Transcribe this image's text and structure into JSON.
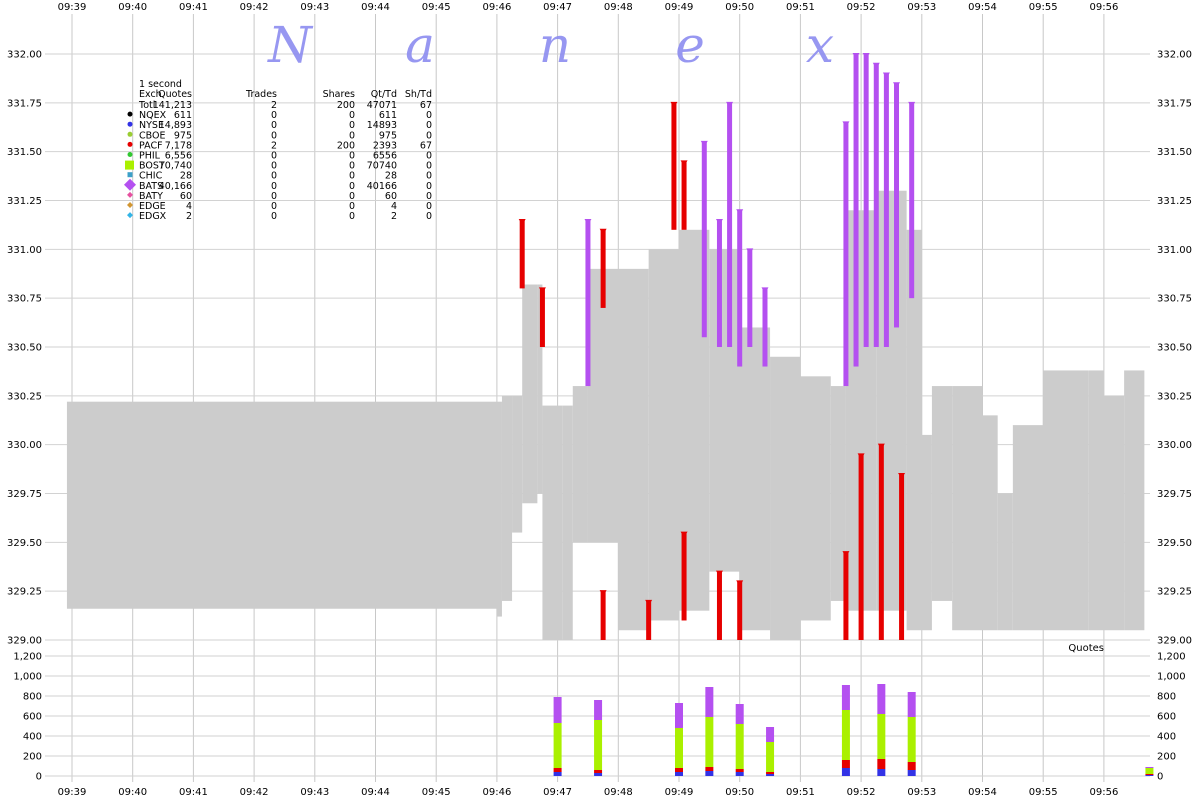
{
  "watermark": [
    "N",
    "a",
    "n",
    "e",
    "x"
  ],
  "chart_data": {
    "type": "line",
    "time_ticks": [
      "09:39",
      "09:40",
      "09:41",
      "09:42",
      "09:43",
      "09:44",
      "09:45",
      "09:46",
      "09:47",
      "09:48",
      "09:49",
      "09:50",
      "09:51",
      "09:52",
      "09:53",
      "09:54",
      "09:55",
      "09:56"
    ],
    "price_panel": {
      "ylim": [
        329.0,
        332.0
      ],
      "y_ticks": [
        "329.00",
        "329.25",
        "329.50",
        "329.75",
        "330.00",
        "330.25",
        "330.50",
        "330.75",
        "331.00",
        "331.25",
        "331.50",
        "331.75",
        "332.00"
      ],
      "nbbo_band": [
        {
          "t": "09:38:55",
          "bid": 329.16,
          "ask": 330.22
        },
        {
          "t": "09:46:00",
          "bid": 329.16,
          "ask": 330.22
        },
        {
          "t": "09:46:00",
          "bid": 329.12,
          "ask": 330.22
        },
        {
          "t": "09:46:05",
          "bid": 329.2,
          "ask": 330.25
        },
        {
          "t": "09:46:15",
          "bid": 329.55,
          "ask": 330.25
        },
        {
          "t": "09:46:25",
          "bid": 329.7,
          "ask": 330.82
        },
        {
          "t": "09:46:40",
          "bid": 329.75,
          "ask": 330.82
        },
        {
          "t": "09:46:45",
          "bid": 329.0,
          "ask": 330.2
        },
        {
          "t": "09:47:05",
          "bid": 329.0,
          "ask": 330.2
        },
        {
          "t": "09:47:15",
          "bid": 329.5,
          "ask": 330.3
        },
        {
          "t": "09:47:30",
          "bid": 329.5,
          "ask": 330.9
        },
        {
          "t": "09:48:00",
          "bid": 329.05,
          "ask": 330.9
        },
        {
          "t": "09:48:30",
          "bid": 329.1,
          "ask": 331.0
        },
        {
          "t": "09:49:00",
          "bid": 329.15,
          "ask": 331.1
        },
        {
          "t": "09:49:30",
          "bid": 329.35,
          "ask": 331.0
        },
        {
          "t": "09:50:00",
          "bid": 329.05,
          "ask": 330.6
        },
        {
          "t": "09:50:30",
          "bid": 329.0,
          "ask": 330.45
        },
        {
          "t": "09:51:00",
          "bid": 329.1,
          "ask": 330.35
        },
        {
          "t": "09:51:30",
          "bid": 329.2,
          "ask": 330.3
        },
        {
          "t": "09:51:45",
          "bid": 329.15,
          "ask": 331.2
        },
        {
          "t": "09:52:15",
          "bid": 329.15,
          "ask": 331.3
        },
        {
          "t": "09:52:45",
          "bid": 329.05,
          "ask": 331.1
        },
        {
          "t": "09:53:00",
          "bid": 329.05,
          "ask": 330.05
        },
        {
          "t": "09:53:10",
          "bid": 329.2,
          "ask": 330.3
        },
        {
          "t": "09:53:30",
          "bid": 329.05,
          "ask": 330.3
        },
        {
          "t": "09:54:00",
          "bid": 329.05,
          "ask": 330.15
        },
        {
          "t": "09:54:15",
          "bid": 329.05,
          "ask": 329.75
        },
        {
          "t": "09:54:30",
          "bid": 329.05,
          "ask": 330.1
        },
        {
          "t": "09:55:00",
          "bid": 329.05,
          "ask": 330.38
        },
        {
          "t": "09:55:45",
          "bid": 329.05,
          "ask": 330.38
        },
        {
          "t": "09:56:00",
          "bid": 329.05,
          "ask": 330.25
        },
        {
          "t": "09:56:20",
          "bid": 329.05,
          "ask": 330.38
        },
        {
          "t": "09:56:40",
          "bid": 329.05,
          "ask": 330.38
        }
      ],
      "quote_spikes": [
        {
          "t": "09:46:25",
          "exch": "PACF",
          "from": 330.8,
          "to": 331.15
        },
        {
          "t": "09:46:45",
          "exch": "PACF",
          "from": 330.5,
          "to": 330.8
        },
        {
          "t": "09:47:30",
          "exch": "BATS",
          "from": 330.3,
          "to": 331.15
        },
        {
          "t": "09:47:45",
          "exch": "PACF",
          "from": 330.7,
          "to": 331.1
        },
        {
          "t": "09:48:55",
          "exch": "PACF",
          "from": 331.1,
          "to": 331.75
        },
        {
          "t": "09:49:05",
          "exch": "PACF",
          "from": 331.1,
          "to": 331.45
        },
        {
          "t": "09:49:25",
          "exch": "BATS",
          "from": 330.55,
          "to": 331.55
        },
        {
          "t": "09:49:40",
          "exch": "BATS",
          "from": 330.5,
          "to": 331.15
        },
        {
          "t": "09:49:50",
          "exch": "BATS",
          "from": 330.5,
          "to": 331.75
        },
        {
          "t": "09:50:00",
          "exch": "BATS",
          "from": 330.4,
          "to": 331.2
        },
        {
          "t": "09:50:10",
          "exch": "BATS",
          "from": 330.5,
          "to": 331.0
        },
        {
          "t": "09:50:25",
          "exch": "BATS",
          "from": 330.4,
          "to": 330.8
        },
        {
          "t": "09:51:45",
          "exch": "BATS",
          "from": 330.3,
          "to": 331.65
        },
        {
          "t": "09:51:55",
          "exch": "BATS",
          "from": 330.4,
          "to": 332.0
        },
        {
          "t": "09:52:05",
          "exch": "BATS",
          "from": 330.5,
          "to": 332.0
        },
        {
          "t": "09:52:15",
          "exch": "BATS",
          "from": 330.5,
          "to": 331.95
        },
        {
          "t": "09:52:25",
          "exch": "BATS",
          "from": 330.5,
          "to": 331.9
        },
        {
          "t": "09:52:35",
          "exch": "BATS",
          "from": 330.6,
          "to": 331.85
        },
        {
          "t": "09:52:50",
          "exch": "BATS",
          "from": 330.75,
          "to": 331.75
        },
        {
          "t": "09:47:45",
          "exch": "PACF",
          "from": 329.0,
          "to": 329.25
        },
        {
          "t": "09:48:30",
          "exch": "PACF",
          "from": 329.0,
          "to": 329.2
        },
        {
          "t": "09:49:05",
          "exch": "PACF",
          "from": 329.1,
          "to": 329.55
        },
        {
          "t": "09:49:40",
          "exch": "PACF",
          "from": 329.0,
          "to": 329.35
        },
        {
          "t": "09:50:00",
          "exch": "PACF",
          "from": 329.0,
          "to": 329.3
        },
        {
          "t": "09:51:45",
          "exch": "PACF",
          "from": 329.0,
          "to": 329.45
        },
        {
          "t": "09:52:00",
          "exch": "PACF",
          "from": 329.0,
          "to": 329.95
        },
        {
          "t": "09:52:20",
          "exch": "PACF",
          "from": 329.0,
          "to": 330.0
        },
        {
          "t": "09:52:40",
          "exch": "PACF",
          "from": 329.0,
          "to": 329.85
        }
      ]
    },
    "volume_panel": {
      "ylim": [
        0,
        1200
      ],
      "y_ticks": [
        "0",
        "200",
        "400",
        "600",
        "800",
        "1,000",
        "1,200"
      ],
      "label": "Quotes",
      "stacks": [
        {
          "t": "09:47:00",
          "BATS": 260,
          "BOST": 450,
          "PACF": 40,
          "NYSE": 40
        },
        {
          "t": "09:47:40",
          "BATS": 200,
          "BOST": 500,
          "PACF": 30,
          "NYSE": 30
        },
        {
          "t": "09:49:00",
          "BATS": 250,
          "BOST": 400,
          "PACF": 40,
          "NYSE": 40
        },
        {
          "t": "09:49:30",
          "BATS": 300,
          "BOST": 500,
          "PACF": 40,
          "NYSE": 50
        },
        {
          "t": "09:50:00",
          "BATS": 200,
          "BOST": 450,
          "PACF": 30,
          "NYSE": 40
        },
        {
          "t": "09:50:30",
          "BATS": 150,
          "BOST": 300,
          "PACF": 20,
          "NYSE": 20
        },
        {
          "t": "09:51:45",
          "BATS": 250,
          "BOST": 500,
          "PACF": 80,
          "NYSE": 80
        },
        {
          "t": "09:52:20",
          "BATS": 300,
          "BOST": 450,
          "PACF": 100,
          "NYSE": 70
        },
        {
          "t": "09:52:50",
          "BATS": 250,
          "BOST": 450,
          "PACF": 80,
          "NYSE": 60
        },
        {
          "t": "09:56:45",
          "BATS": 10,
          "BOST": 60,
          "PACF": 10,
          "NYSE": 10
        }
      ]
    },
    "colors": {
      "NQEX": "#000000",
      "NYSE": "#3232e6",
      "CBOE": "#9acd32",
      "PACF": "#e60000",
      "PHIL": "#32c832",
      "BOST": "#aaf000",
      "CHIC": "#3ca0c8",
      "BATS": "#b450f0",
      "BATY": "#e650a0",
      "EDGE": "#d29632",
      "EDGX": "#32b4e6",
      "band": "#cccccc"
    },
    "legend": {
      "title": "1 second",
      "headers": [
        "Exch",
        "Quotes",
        "Trades",
        "Shares",
        "Qt/Td",
        "Sh/Td"
      ],
      "rows": [
        {
          "exch": "Totl",
          "quotes": "141,213",
          "trades": "2",
          "shares": "200",
          "qttd": "47071",
          "shtd": "67",
          "marker": ""
        },
        {
          "exch": "NQEX",
          "quotes": "611",
          "trades": "0",
          "shares": "0",
          "qttd": "611",
          "shtd": "0",
          "marker": "NQEX"
        },
        {
          "exch": "NYSE",
          "quotes": "14,893",
          "trades": "0",
          "shares": "0",
          "qttd": "14893",
          "shtd": "0",
          "marker": "NYSE"
        },
        {
          "exch": "CBOE",
          "quotes": "975",
          "trades": "0",
          "shares": "0",
          "qttd": "975",
          "shtd": "0",
          "marker": "CBOE"
        },
        {
          "exch": "PACF",
          "quotes": "7,178",
          "trades": "2",
          "shares": "200",
          "qttd": "2393",
          "shtd": "67",
          "marker": "PACF"
        },
        {
          "exch": "PHIL",
          "quotes": "6,556",
          "trades": "0",
          "shares": "0",
          "qttd": "6556",
          "shtd": "0",
          "marker": "PHIL"
        },
        {
          "exch": "BOST",
          "quotes": "70,740",
          "trades": "0",
          "shares": "0",
          "qttd": "70740",
          "shtd": "0",
          "marker": "BOST"
        },
        {
          "exch": "CHIC",
          "quotes": "28",
          "trades": "0",
          "shares": "0",
          "qttd": "28",
          "shtd": "0",
          "marker": "CHIC"
        },
        {
          "exch": "BATS",
          "quotes": "40,166",
          "trades": "0",
          "shares": "0",
          "qttd": "40166",
          "shtd": "0",
          "marker": "BATS"
        },
        {
          "exch": "BATY",
          "quotes": "60",
          "trades": "0",
          "shares": "0",
          "qttd": "60",
          "shtd": "0",
          "marker": "BATY"
        },
        {
          "exch": "EDGE",
          "quotes": "4",
          "trades": "0",
          "shares": "0",
          "qttd": "4",
          "shtd": "0",
          "marker": "EDGE"
        },
        {
          "exch": "EDGX",
          "quotes": "2",
          "trades": "0",
          "shares": "0",
          "qttd": "2",
          "shtd": "0",
          "marker": "EDGX"
        }
      ]
    }
  }
}
